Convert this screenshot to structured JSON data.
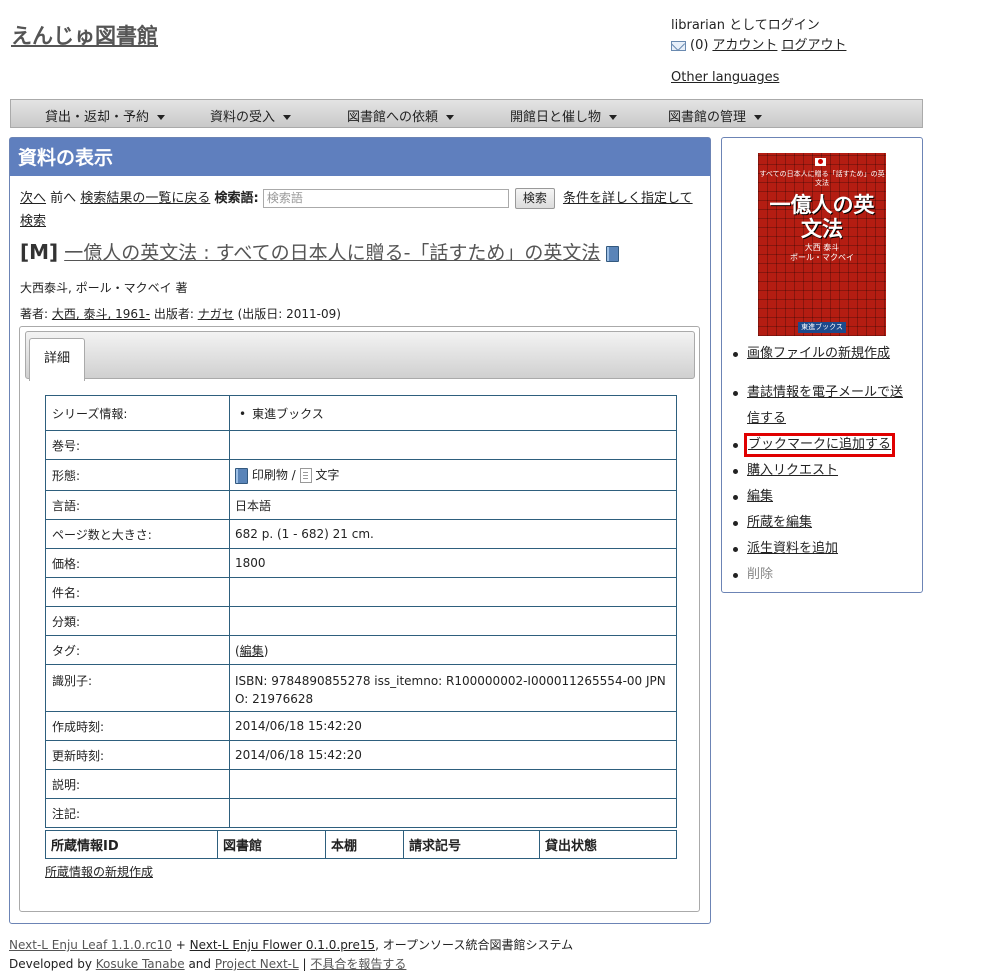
{
  "header": {
    "site_title": "えんじゅ図書館",
    "login_text": "librarian としてログイン",
    "message_count": "(0)",
    "account_label": "アカウント",
    "logout_label": "ログアウト",
    "other_languages": "Other languages"
  },
  "nav": {
    "items": [
      {
        "label": "貸出・返却・予約"
      },
      {
        "label": "資料の受入"
      },
      {
        "label": "図書館への依頼"
      },
      {
        "label": "開館日と催し物"
      },
      {
        "label": "図書館の管理"
      }
    ]
  },
  "main": {
    "title": "資料の表示",
    "next_label": "次へ",
    "prev_label": "前へ",
    "back_to_results": "検索結果の一覧に戻る",
    "search_label": "検索語:",
    "search_placeholder": "検索語",
    "search_button": "検索",
    "advanced_search": "条件を詳しく指定して検索",
    "title_prefix": "[M]",
    "book_title": "一億人の英文法 : すべての日本人に贈る-「話すため」の英文法",
    "responsibility": "大西泰斗, ポール・マクベイ 著",
    "creators_label": "著者:",
    "creator_name": "大西, 泰斗, 1961-",
    "publisher_label": "出版者:",
    "publisher_name": "ナガセ",
    "pub_date": "(出版日: 2011-09)"
  },
  "tabs": {
    "detail_label": "詳細"
  },
  "details": {
    "series_label": "シリーズ情報:",
    "series_value": "東進ブックス",
    "volume_label": "巻号:",
    "form_label": "形態:",
    "form_carrier": "印刷物",
    "form_separator": "/",
    "form_content": "文字",
    "language_label": "言語:",
    "language_value": "日本語",
    "pages_label": "ページ数と大きさ:",
    "pages_value": "682 p. (1 - 682) 21 cm.",
    "price_label": "価格:",
    "price_value": "1800",
    "subject_label": "件名:",
    "classification_label": "分類:",
    "tag_label": "タグ:",
    "tag_open": "(",
    "tag_edit": "編集",
    "tag_close": ")",
    "identifier_label": "識別子:",
    "identifier_value": "ISBN: 9784890855278 iss_itemno: R100000002-I000011265554-00 JPNO: 21976628",
    "created_label": "作成時刻:",
    "created_value": "2014/06/18 15:42:20",
    "updated_label": "更新時刻:",
    "updated_value": "2014/06/18 15:42:20",
    "description_label": "説明:",
    "note_label": "注記:"
  },
  "holdings": {
    "headers": [
      "所蔵情報ID",
      "図書館",
      "本棚",
      "請求記号",
      "貸出状態"
    ],
    "new_item_link": "所蔵情報の新規作成"
  },
  "sidebar": {
    "cover": {
      "small_text": "すべての日本人に贈る「話すため」の英文法",
      "big_title": "一億人の英文法",
      "author": "大西 泰斗",
      "author2": "ポール・マクベイ",
      "publisher": "東進ブックス"
    },
    "new_image": "画像ファイルの新規作成",
    "send_email": "書誌情報を電子メールで送信する",
    "add_bookmark": "ブックマークに追加する",
    "purchase_request": "購入リクエスト",
    "edit": "編集",
    "edit_items": "所蔵を編集",
    "add_derivative": "派生資料を追加",
    "delete": "削除",
    "highlight_color": "#e00000"
  },
  "footer": {
    "leaf": "Next-L Enju Leaf 1.1.0.rc10",
    "plus": "+",
    "flower": "Next-L Enju Flower 0.1.0.pre15",
    "system": ", オープンソース統合図書館システム",
    "developed_by": "Developed by",
    "author": "Kosuke Tanabe",
    "and": "and",
    "project": "Project Next-L",
    "sep": "|",
    "report": "不具合を報告する"
  }
}
